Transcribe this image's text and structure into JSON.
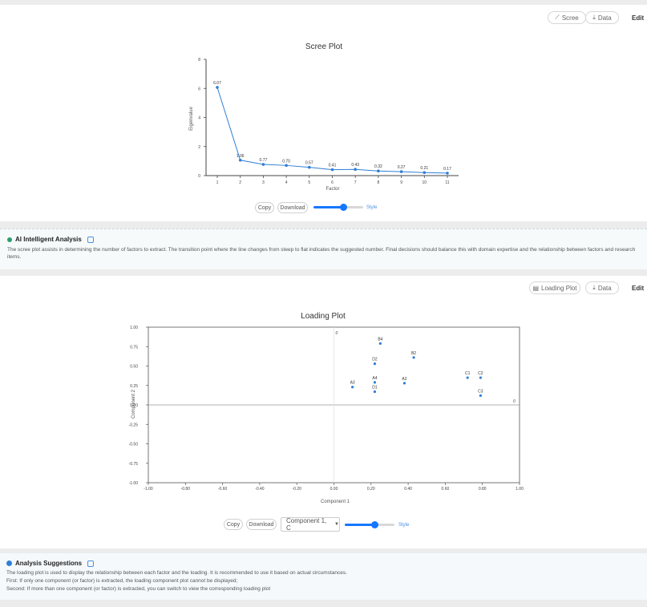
{
  "scree": {
    "toolbar": {
      "scree_label": "Scree",
      "data_label": "Data",
      "edit_label": "Edit"
    },
    "controls": {
      "copy_label": "Copy",
      "download_label": "Download",
      "slider_value": 0.6,
      "style_label": "Style"
    },
    "chart_data": {
      "type": "line",
      "title": "Scree Plot",
      "xlabel": "Factor",
      "ylabel": "Eigenvalue",
      "x": [
        1,
        2,
        3,
        4,
        5,
        6,
        7,
        8,
        9,
        10,
        11
      ],
      "values": [
        6.07,
        1.06,
        0.77,
        0.7,
        0.57,
        0.41,
        0.43,
        0.32,
        0.27,
        0.21,
        0.17
      ],
      "labels": [
        "6.07",
        "1.06",
        "0.77",
        "0.70",
        "0.57",
        "0.41",
        "0.43",
        "0.32",
        "0.27",
        "0.21",
        "0.17"
      ],
      "yticks": [
        0,
        2,
        4,
        6,
        8
      ],
      "ylim": [
        0,
        8
      ],
      "grid": false,
      "color": "#2f7fd6"
    }
  },
  "ai": {
    "title": "AI Intelligent Analysis",
    "text": "The scree plot assists in determining the number of factors to extract. The transition point where the line changes from steep to flat indicates the suggested number. Final decisions should balance this with domain expertise and the relationship between factors and research items."
  },
  "loading": {
    "toolbar": {
      "plot_label": "Loading Plot",
      "data_label": "Data",
      "edit_label": "Edit"
    },
    "controls": {
      "copy_label": "Copy",
      "download_label": "Download",
      "select_value": "Component 1, C",
      "slider_value": 0.6,
      "style_label": "Style"
    },
    "chart_data": {
      "type": "scatter",
      "title": "Loading Plot",
      "xlabel": "Component 1",
      "ylabel": "Component 2",
      "xlim": [
        -1,
        1
      ],
      "ylim": [
        -1,
        1
      ],
      "xticks": [
        "-1.00",
        "-0.80",
        "-0.60",
        "-0.40",
        "-0.20",
        "0.00",
        "0.20",
        "0.40",
        "0.60",
        "0.80",
        "1.00"
      ],
      "yticks": [
        "1.00",
        "0.75",
        "0.50",
        "0.25",
        "0.00",
        "-0.25",
        "-0.50",
        "-0.75",
        "-1.00"
      ],
      "axis_marker": "0",
      "points": [
        {
          "name": "B4",
          "x": 0.25,
          "y": 0.79
        },
        {
          "name": "B2",
          "x": 0.43,
          "y": 0.61
        },
        {
          "name": "D2",
          "x": 0.22,
          "y": 0.53
        },
        {
          "name": "C1",
          "x": 0.72,
          "y": 0.35
        },
        {
          "name": "C2",
          "x": 0.79,
          "y": 0.35
        },
        {
          "name": "A2",
          "x": 0.38,
          "y": 0.28
        },
        {
          "name": "A3",
          "x": 0.1,
          "y": 0.23
        },
        {
          "name": "A4",
          "x": 0.22,
          "y": 0.29
        },
        {
          "name": "D1",
          "x": 0.22,
          "y": 0.17
        },
        {
          "name": "C3",
          "x": 0.79,
          "y": 0.12
        }
      ],
      "grid": false,
      "color": "#2f7fd6"
    }
  },
  "suggestions": {
    "title": "Analysis Suggestions",
    "lines": [
      "The loading plot is used to display the relationship between each factor and the loading. It is recommended to use it based on actual circumstances.",
      "First: If only one component (or factor) is extracted, the loading component plot cannot be displayed;",
      "Second: If more than one component (or factor) is extracted, you can switch to view the corresponding loading plot"
    ]
  }
}
